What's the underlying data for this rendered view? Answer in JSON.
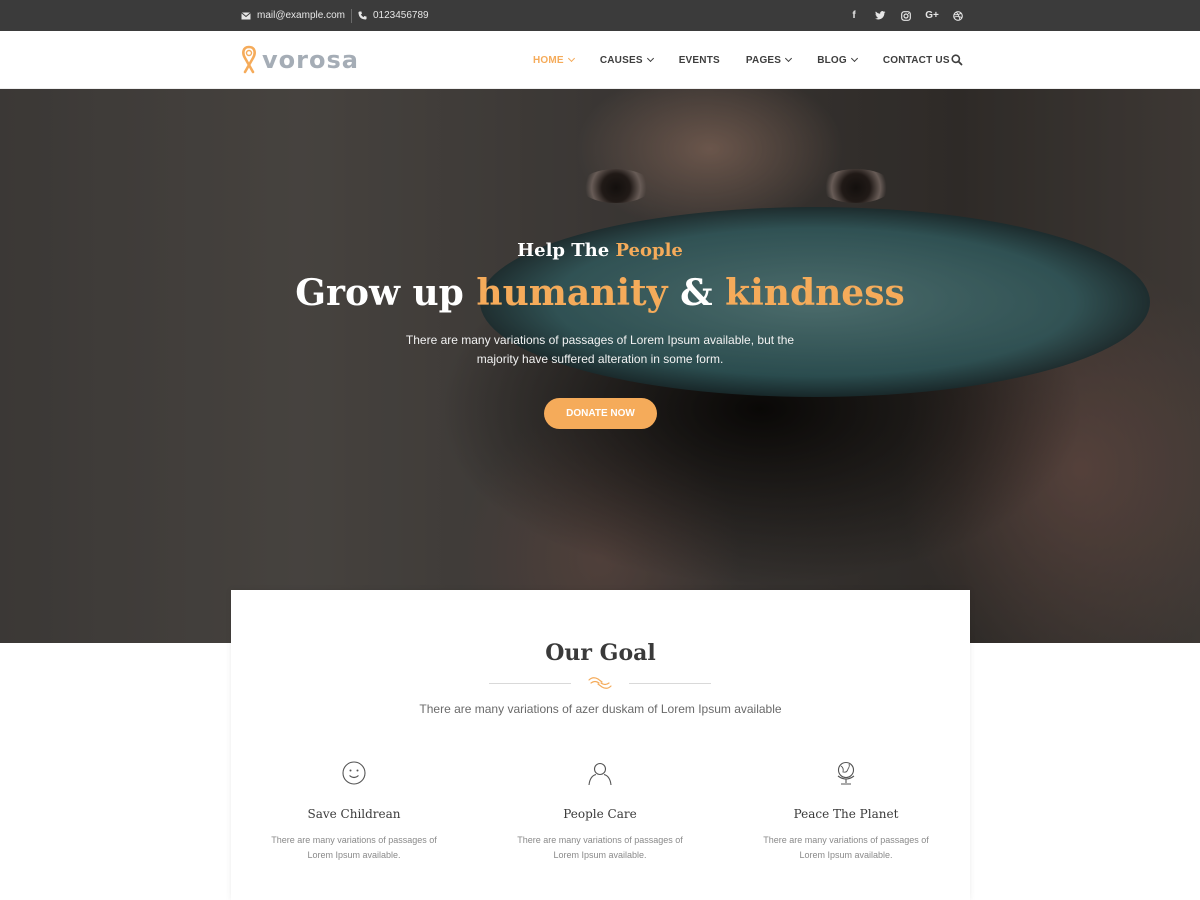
{
  "topbar": {
    "email": "mail@example.com",
    "phone": "0123456789",
    "social_icons": [
      "facebook-icon",
      "twitter-icon",
      "instagram-icon",
      "google-plus-icon",
      "dribbble-icon"
    ],
    "social_glyphs": {
      "facebook": "f",
      "google_plus": "G+"
    }
  },
  "header": {
    "logo_text": "vorosa",
    "nav": [
      {
        "label": "HOME",
        "has_dropdown": true,
        "active": true
      },
      {
        "label": "CAUSES",
        "has_dropdown": true,
        "active": false
      },
      {
        "label": "EVENTS",
        "has_dropdown": false,
        "active": false
      },
      {
        "label": "PAGES",
        "has_dropdown": true,
        "active": false
      },
      {
        "label": "BLOG",
        "has_dropdown": true,
        "active": false
      },
      {
        "label": "CONTACT US",
        "has_dropdown": false,
        "active": false
      }
    ],
    "search_icon": "search-icon"
  },
  "hero": {
    "subtitle_plain": "Help The",
    "subtitle_accent": "People",
    "title_part1": "Grow up",
    "title_accent1": "humanity",
    "title_part2": "&",
    "title_accent2": "kindness",
    "description": "There are many variations of passages of Lorem Ipsum available, but the majority have suffered alteration in some form.",
    "cta_label": "DONATE NOW"
  },
  "goal": {
    "heading": "Our Goal",
    "intro": "There are many variations of azer duskam of Lorem Ipsum available",
    "features": [
      {
        "icon": "smiley-icon",
        "title": "Save Childrean",
        "text": "There are many variations of passages of Lorem Ipsum available."
      },
      {
        "icon": "person-icon",
        "title": "People Care",
        "text": "There are many variations of passages of Lorem Ipsum available."
      },
      {
        "icon": "globe-icon",
        "title": "Peace The Planet",
        "text": "There are many variations of passages of Lorem Ipsum available."
      }
    ]
  },
  "colors": {
    "accent": "#f5ab5a",
    "topbar_bg": "#3b3b3b",
    "nav_text": "#3e3e3e",
    "logo_text": "#a5adb6"
  }
}
